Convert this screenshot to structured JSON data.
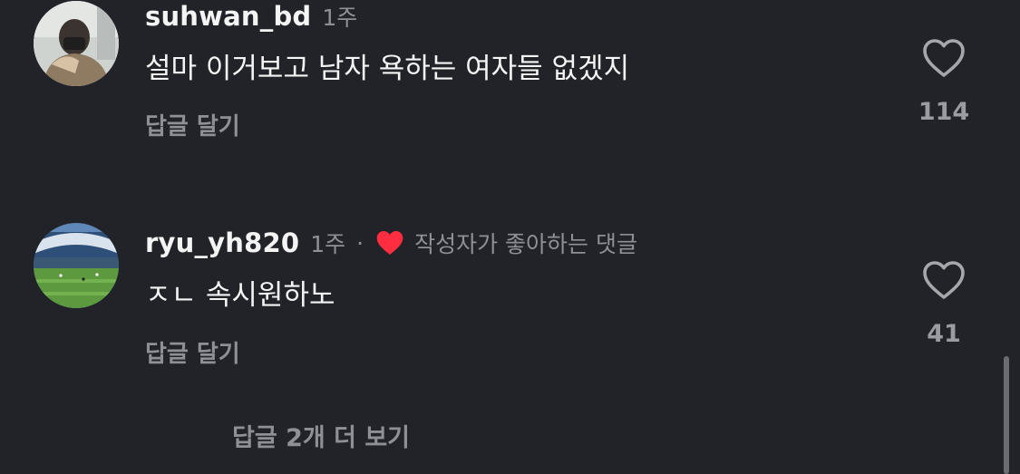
{
  "comments": [
    {
      "username": "suhwan_bd",
      "time": "1주",
      "text": "설마 이거보고 남자 욕하는 여자들 없겠지",
      "reply_label": "답글 달기",
      "like_count": "114",
      "liked_by_author": false
    },
    {
      "username": "ryu_yh820",
      "time": "1주",
      "separator": "·",
      "liked_label": "작성자가 좋아하는 댓글",
      "text": "ㅈㄴ 속시원하노",
      "reply_label": "답글 달기",
      "like_count": "41",
      "liked_by_author": true
    }
  ],
  "more_replies_label": "답글 2개 더 보기",
  "colors": {
    "background": "#212328",
    "muted_text": "#8e9096",
    "heart_red": "#ff2d3f"
  },
  "icons": {
    "like": "heart-outline-icon",
    "author_liked": "heart-filled-icon"
  }
}
